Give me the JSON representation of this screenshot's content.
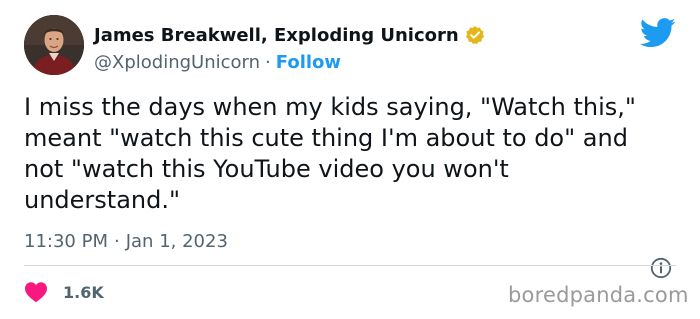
{
  "author": {
    "display_name": "James Breakwell, Exploding Unicorn",
    "handle": "@XplodingUnicorn",
    "separator": "·",
    "follow_label": "Follow",
    "verified_badge": "verified-gold-badge",
    "verified_color": "#e2b719"
  },
  "tweet": {
    "text": "I miss the days when my kids saying, \"Watch this,\"\nmeant \"watch this cute thing I'm about to do\" and\nnot \"watch this YouTube video you won't\nunderstand.\"",
    "time": "11:30 PM",
    "separator": "·",
    "date": "Jan 1, 2023"
  },
  "engagement": {
    "likes": "1.6K",
    "like_icon": "heart-icon",
    "like_color": "#f91880"
  },
  "icons": {
    "brand": "twitter-bird-icon",
    "info": "info-icon"
  },
  "colors": {
    "link": "#1d9bf0",
    "muted": "#536471",
    "text": "#0f1419"
  },
  "watermark": "boredpanda.com"
}
